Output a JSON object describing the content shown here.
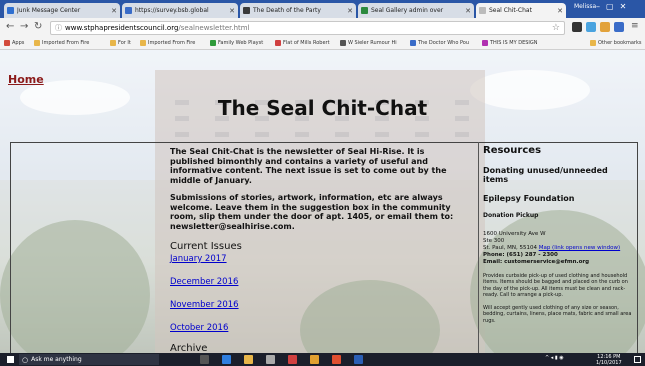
{
  "browser": {
    "tabs": [
      {
        "label": "Junk Message Center",
        "color": "#2f6fd0"
      },
      {
        "label": "https://survey.bsb.global",
        "color": "#3a6cc8"
      },
      {
        "label": "The Death of the Party",
        "color": "#3a3a3a"
      },
      {
        "label": "Seal Gallery admin over",
        "color": "#2c8a3e"
      },
      {
        "label": "Seal Chit-Chat",
        "color": "#bbbbbb"
      }
    ],
    "window_user": "Melissa",
    "url_host": "www.stphapresidentscouncil.org",
    "url_path": "/sealnewsletter.html",
    "bookmarks": [
      {
        "label": "Apps",
        "color": "#d24a3a"
      },
      {
        "label": "Imported From Fire",
        "color": "#e8b64a"
      },
      {
        "label": "For It",
        "color": "#e8b64a"
      },
      {
        "label": "Imported From Fire",
        "color": "#e8b64a"
      },
      {
        "label": "Family Web Playst",
        "color": "#2e9a3a"
      },
      {
        "label": "Flat of Mills Robert",
        "color": "#d04040"
      },
      {
        "label": "W Sieler Rumour Hi",
        "color": "#555555"
      },
      {
        "label": "The Doctor Who Pou",
        "color": "#3a6cc8"
      },
      {
        "label": "THIS IS MY DESIGN",
        "color": "#b030b0"
      },
      {
        "label": "Other bookmarks",
        "color": "#e8b64a"
      }
    ]
  },
  "page": {
    "home_link": "Home",
    "title": "The Seal Chit-Chat",
    "intro_1": "The Seal Chit-Chat is the newsletter of Seal Hi-Rise.  It is published bimonthly and contains a variety of useful and informative content.  The next issue is set to come out by the middle of January.",
    "intro_2": "Submissions of stories, artwork, information, etc are always welcome.  Leave them in the suggestion box in the community room, slip them under the door of apt. 1405, or email them to: newsletter@sealhirise.com.",
    "current_issues_heading": "Current Issues",
    "issues": [
      "January 2017",
      "December 2016",
      "November 2016",
      "October 2016"
    ],
    "archive_heading": "Archive"
  },
  "resources": {
    "heading": "Resources",
    "item_1": "Donating unused/unneeded items",
    "item_2": "Epilepsy Foundation",
    "sub_1": "Donation Pickup",
    "address_line_1": "1600 University Ave W",
    "address_line_2": "Ste 300",
    "address_line_3": "St. Paul, MN, 55104",
    "map_link": "Map (link opens new window)",
    "phone": "Phone: (651) 287 - 2300",
    "email": "Email: customerservice@efmn.org",
    "para_1": "Provides curbside pick-up of used clothing and household items. Items should be bagged and placed on the curb on the day of the pick-up. All items must be clean and rack-ready. Call to arrange a pick-up.",
    "para_2": "Will accept gently used clothing of any size or season, bedding, curtains, linens, place mats, fabric and small area rugs."
  },
  "taskbar": {
    "search_placeholder": "Ask me anything",
    "time": "12:16 PM",
    "date": "1/10/2017"
  }
}
